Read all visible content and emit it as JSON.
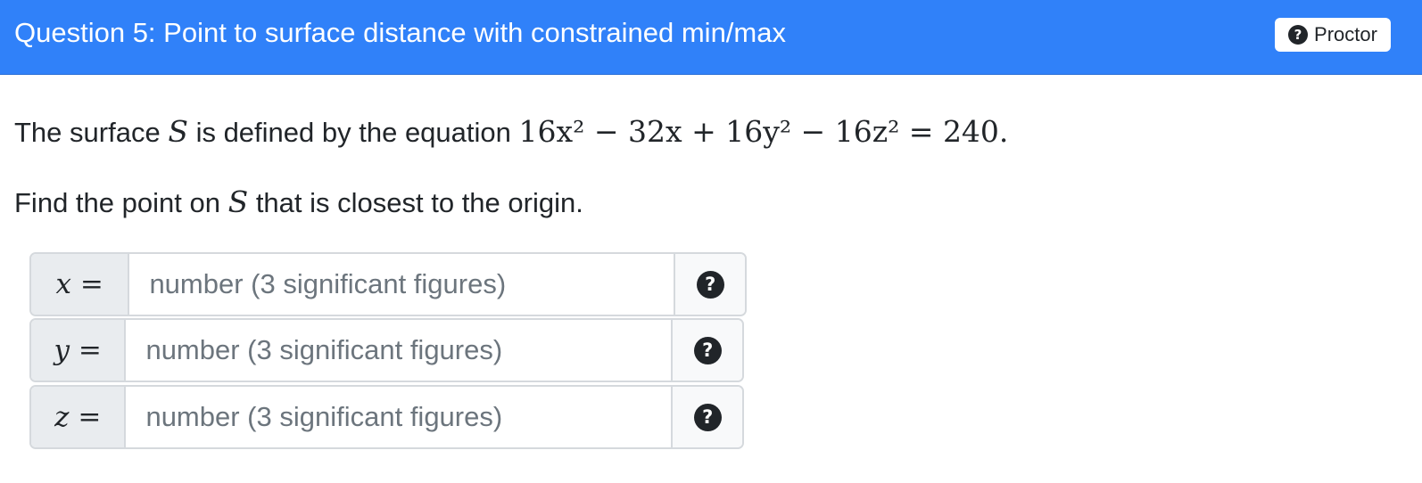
{
  "header": {
    "title": "Question 5: Point to surface distance with constrained min/max",
    "proctor_label": "Proctor",
    "background": "#3081f9"
  },
  "question": {
    "line1_prefix": "The surface",
    "surface_symbol": "S",
    "line1_middle": "is defined by the equation",
    "equation_text": "16x² − 32x + 16y² − 16z² = 240.",
    "line2_prefix": "Find the point on",
    "line2_suffix": "that is closest to the origin."
  },
  "answers": [
    {
      "variable": "x",
      "equals": "=",
      "placeholder": "number (3 significant figures)",
      "value": ""
    },
    {
      "variable": "y",
      "equals": "=",
      "placeholder": "number (3 significant figures)",
      "value": ""
    },
    {
      "variable": "z",
      "equals": "=",
      "placeholder": "number (3 significant figures)",
      "value": ""
    }
  ],
  "icons": {
    "help": "question-circle-icon",
    "proctor": "question-circle-icon"
  }
}
